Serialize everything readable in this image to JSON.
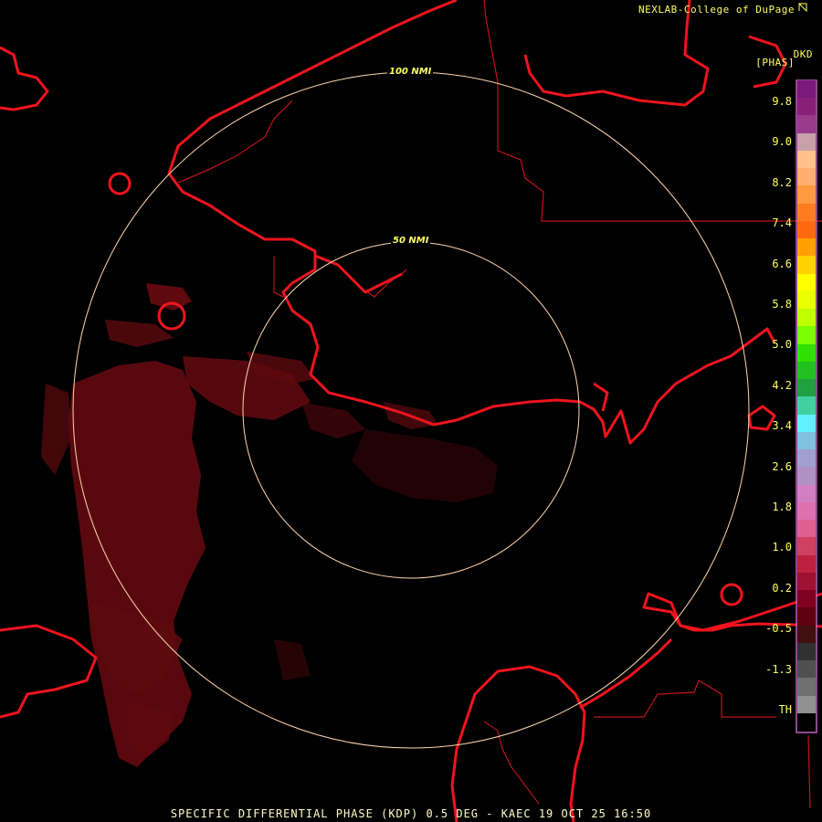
{
  "header": {
    "credit": "NEXLAB-College of DuPage",
    "product_code": "DKD",
    "units": "[PHAS]"
  },
  "footer": {
    "caption": "SPECIFIC DIFFERENTIAL PHASE (KDP) 0.5 DEG - KAEC 19 OCT 25 16:50"
  },
  "range_rings": [
    {
      "label": "50 NMI"
    },
    {
      "label": "100 NMI"
    }
  ],
  "legend": {
    "ticks": [
      "9.8",
      "9.0",
      "8.2",
      "7.4",
      "6.6",
      "5.8",
      "5.0",
      "4.2",
      "3.4",
      "2.6",
      "1.8",
      "1.0",
      "0.2",
      "-0.5",
      "-1.3",
      "TH"
    ],
    "colors": [
      "#7a1a7a",
      "#8a1f7a",
      "#9a3a8a",
      "#c8a0a8",
      "#ffc08c",
      "#ffb070",
      "#ff9a40",
      "#ff7d20",
      "#ff6a10",
      "#ffa000",
      "#ffd000",
      "#ffff00",
      "#e8ff00",
      "#c0ff00",
      "#7aff00",
      "#30e000",
      "#20c020",
      "#20a040",
      "#40d0a0",
      "#60f0ff",
      "#80c0e0",
      "#a0a0d0",
      "#b090c0",
      "#d080c0",
      "#e070b0",
      "#e06090",
      "#d04060",
      "#c02040",
      "#a01030",
      "#800020",
      "#600010",
      "#401010",
      "#303030",
      "#505050",
      "#707070",
      "#909090",
      "#000000"
    ]
  },
  "site": "KAEC"
}
